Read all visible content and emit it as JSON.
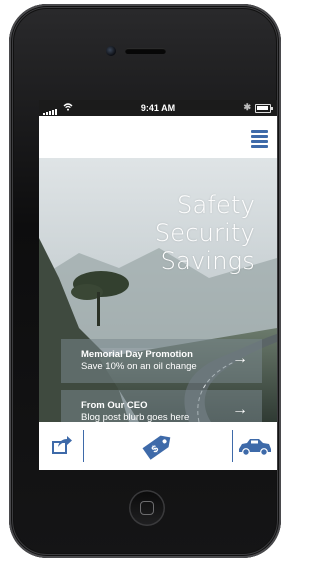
{
  "status_bar": {
    "time": "9:41 AM"
  },
  "header": {
    "menu_icon": "hamburger-menu-icon"
  },
  "hero": {
    "tagline": [
      "Safety",
      "Security",
      "Savings"
    ]
  },
  "promos": [
    {
      "title": "Memorial Day Promotion",
      "subtitle": "Save 10% on an oil change",
      "arrow": "→"
    },
    {
      "title": "From Our CEO",
      "subtitle": "Blog post blurb goes here",
      "arrow": "→"
    }
  ],
  "tab_bar": {
    "items": [
      {
        "icon": "share-icon"
      },
      {
        "icon": "price-tag-icon"
      },
      {
        "icon": "car-icon"
      }
    ]
  },
  "colors": {
    "accent": "#3e6aa9",
    "status_bar": "#1b1b1b",
    "promo_overlay": "#78878c"
  }
}
